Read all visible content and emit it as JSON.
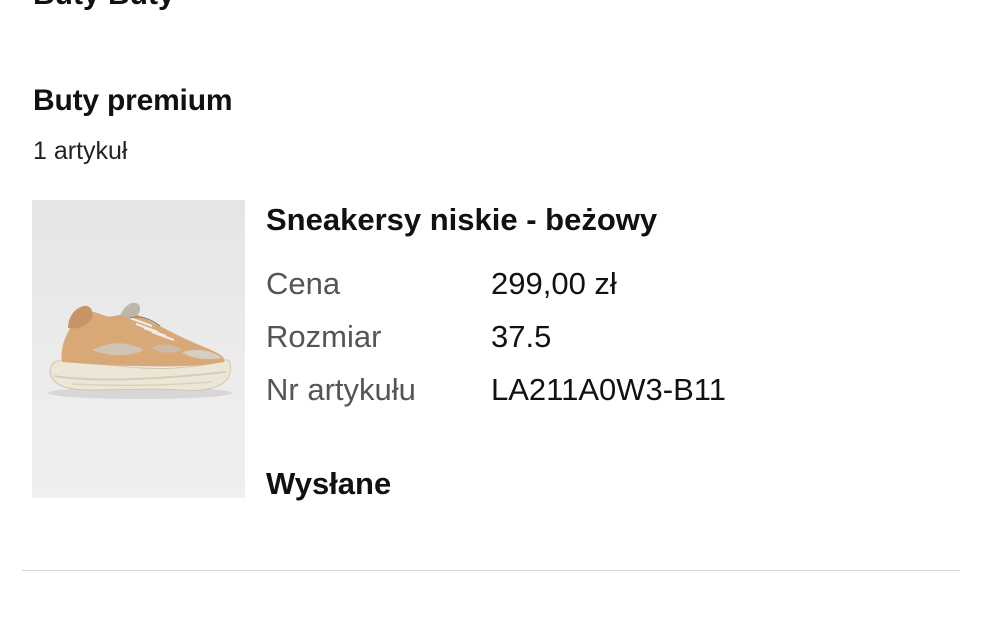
{
  "header": {
    "cut_heading": "Buty Buty"
  },
  "section": {
    "title": "Buty premium",
    "count": "1 artykuł"
  },
  "item": {
    "image_icon": "sneaker-image",
    "name": "Sneakersy niskie - beżowy",
    "details": [
      {
        "label": "Cena",
        "value": "299,00 zł"
      },
      {
        "label": "Rozmiar",
        "value": "37.5"
      },
      {
        "label": "Nr artykułu",
        "value": "LA211A0W3-B11"
      }
    ],
    "status": "Wysłane"
  },
  "colors": {
    "text_primary": "#111111",
    "text_secondary": "#555555",
    "divider": "#d7d7d7",
    "shoe_upper": "#d9a877",
    "shoe_sole": "#ece6d6"
  }
}
